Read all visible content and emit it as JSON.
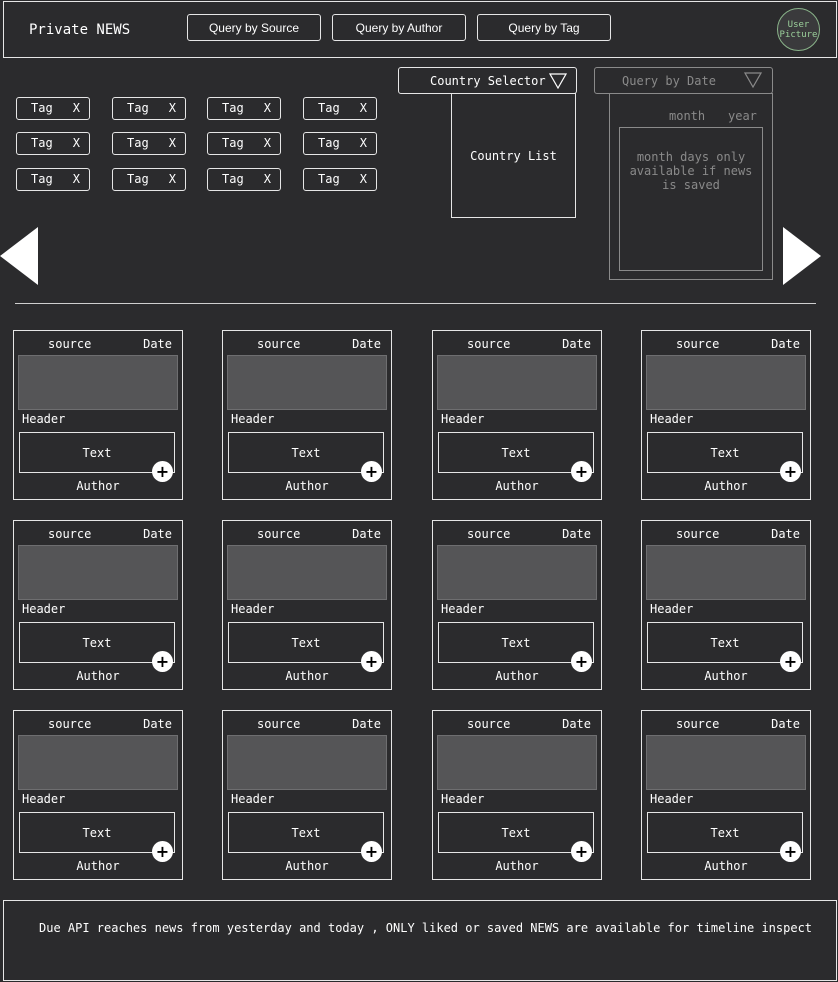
{
  "header": {
    "brand": "Private NEWS",
    "buttons": [
      {
        "label": "Query by Source"
      },
      {
        "label": "Query by Author"
      },
      {
        "label": "Query by Tag"
      }
    ],
    "avatar_label": "User Picture"
  },
  "tags": {
    "items": [
      {
        "label": "Tag",
        "close": "X"
      },
      {
        "label": "Tag",
        "close": "X"
      },
      {
        "label": "Tag",
        "close": "X"
      },
      {
        "label": "Tag",
        "close": "X"
      },
      {
        "label": "Tag",
        "close": "X"
      },
      {
        "label": "Tag",
        "close": "X"
      },
      {
        "label": "Tag",
        "close": "X"
      },
      {
        "label": "Tag",
        "close": "X"
      },
      {
        "label": "Tag",
        "close": "X"
      },
      {
        "label": "Tag",
        "close": "X"
      },
      {
        "label": "Tag",
        "close": "X"
      },
      {
        "label": "Tag",
        "close": "X"
      }
    ]
  },
  "country": {
    "selector_label": "Country Selector",
    "list_label": "Country List"
  },
  "date_filter": {
    "selector_label": "Query by Date",
    "month_label": "month",
    "year_label": "year",
    "days_note": "month days only available if news is saved"
  },
  "news_cards": [
    {
      "source": "source",
      "date": "Date",
      "header": "Header",
      "text": "Text",
      "author": "Author"
    },
    {
      "source": "source",
      "date": "Date",
      "header": "Header",
      "text": "Text",
      "author": "Author"
    },
    {
      "source": "source",
      "date": "Date",
      "header": "Header",
      "text": "Text",
      "author": "Author"
    },
    {
      "source": "source",
      "date": "Date",
      "header": "Header",
      "text": "Text",
      "author": "Author"
    },
    {
      "source": "source",
      "date": "Date",
      "header": "Header",
      "text": "Text",
      "author": "Author"
    },
    {
      "source": "source",
      "date": "Date",
      "header": "Header",
      "text": "Text",
      "author": "Author"
    },
    {
      "source": "source",
      "date": "Date",
      "header": "Header",
      "text": "Text",
      "author": "Author"
    },
    {
      "source": "source",
      "date": "Date",
      "header": "Header",
      "text": "Text",
      "author": "Author"
    },
    {
      "source": "source",
      "date": "Date",
      "header": "Header",
      "text": "Text",
      "author": "Author"
    },
    {
      "source": "source",
      "date": "Date",
      "header": "Header",
      "text": "Text",
      "author": "Author"
    },
    {
      "source": "source",
      "date": "Date",
      "header": "Header",
      "text": "Text",
      "author": "Author"
    },
    {
      "source": "source",
      "date": "Date",
      "header": "Header",
      "text": "Text",
      "author": "Author"
    }
  ],
  "card_action_symbol": "+",
  "footer": {
    "note": "Due API reaches news from yesterday and today , ONLY liked or saved NEWS are available for timeline inspect"
  },
  "colors": {
    "background": "#2b2b2d",
    "border": "#e6e6e6",
    "disabled": "#8a8a8a",
    "image_placeholder": "#555557",
    "avatar_accent": "#9bd09b"
  },
  "icons": {
    "prev": "triangle-left-icon",
    "next": "triangle-right-icon",
    "dropdown": "triangle-down-outline-icon",
    "add": "plus-circle-icon"
  }
}
